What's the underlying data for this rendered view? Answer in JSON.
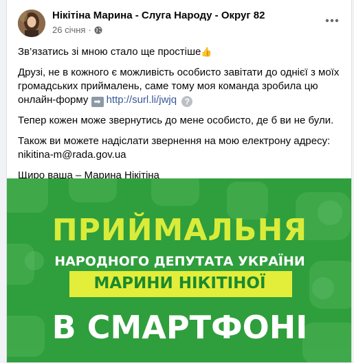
{
  "post": {
    "author": "Нікітіна Марина - Слуга Народу - Округ 82",
    "date": "26 січня",
    "separator": "·",
    "privacy_icon": "globe-icon",
    "more_icon": "more-horizontal-icon"
  },
  "content": {
    "line1": "Зв’язатись зі мною стало ще простіше",
    "line1_emoji": "👍",
    "para2_text": "Друзі, не в кожного є можливість особисто завітати до однієї з моїх громадських приймалень, саме тому моя команда зробила цю онлайн-форму",
    "para2_arrow": "➡",
    "link": "http://surl.li/jwjq",
    "help_glyph": "?",
    "para3": "Тепер кожен може звернутись до мене особисто, де б ви не були.",
    "para4_text": "Також ви можете надіслати звернення на мою електрону адресу:",
    "email": "nikitina-m@rada.gov.ua",
    "signature": "Щиро ваша – Марина Нікітіна"
  },
  "image": {
    "title1": "ПРИЙМАЛЬНЯ",
    "title2": "НАРОДНОГО ДЕПУТАТА УКРАЇНИ",
    "title3": "МАРИНИ НІКІТІНОЇ",
    "title4": "В СМАРТФОНІ",
    "colors": {
      "bg": "#2f9e3c",
      "accent": "#d9ec3a",
      "box": "#e3ee3b",
      "box_text": "#1b8a2e"
    }
  }
}
